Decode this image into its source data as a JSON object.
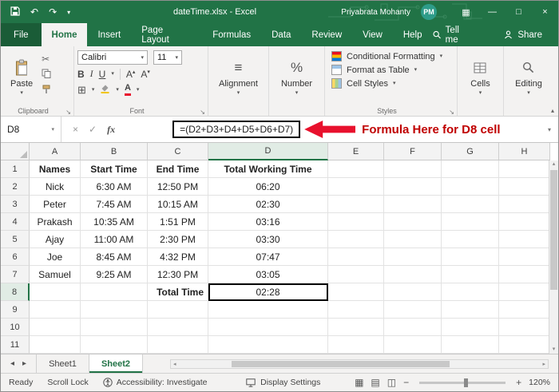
{
  "colors": {
    "excel_green": "#217346",
    "annotation_red": "#C00000",
    "arrow_red": "#E8112D",
    "selection": "#000000"
  },
  "titlebar": {
    "title": "dateTime.xlsx - Excel",
    "user": "Priyabrata Mohanty",
    "avatar": "PM"
  },
  "icons": {
    "undo": "↶",
    "redo": "↷",
    "dropdown": "▾",
    "up": "▴",
    "left": "◂",
    "right": "▸",
    "ribbon_display": "▦",
    "minimize": "—",
    "maximize": "□",
    "close": "×",
    "cancel": "×",
    "enter": "✓",
    "fx": "fx",
    "scissors": "✂",
    "borders": "⊞",
    "align_lines": "≡",
    "percent": "%",
    "bold": "B",
    "italic": "I",
    "underline": "U",
    "view_normal": "▦",
    "view_layout": "▤",
    "view_break": "◫",
    "zoom_out": "−",
    "zoom_in": "+",
    "launcher": "↘"
  },
  "ribbon": {
    "tabs": [
      "File",
      "Home",
      "Insert",
      "Page Layout",
      "Formulas",
      "Data",
      "Review",
      "View",
      "Help"
    ],
    "active_tab": "Home",
    "tell_me": "Tell me",
    "share": "Share"
  },
  "groups": {
    "clipboard": {
      "label": "Clipboard",
      "paste": "Paste"
    },
    "font": {
      "label": "Font",
      "font_name": "Calibri",
      "font_size": "11"
    },
    "alignment": {
      "label": "Alignment"
    },
    "number": {
      "label": "Number"
    },
    "styles": {
      "label": "Styles",
      "items": [
        "Conditional Formatting",
        "Format as Table",
        "Cell Styles"
      ]
    },
    "cells": {
      "label": "Cells"
    },
    "editing": {
      "label": "Editing"
    }
  },
  "formula_bar": {
    "name_box": "D8",
    "formula": "=(D2+D3+D4+D5+D6+D7)",
    "annotation": "Formula Here for D8 cell"
  },
  "grid": {
    "columns": [
      "A",
      "B",
      "C",
      "D",
      "E",
      "F",
      "G",
      "H"
    ],
    "selected_cell": "D8",
    "selected_col": "D",
    "selected_row": "8",
    "bold_cells": [
      "C8"
    ],
    "rows": [
      {
        "n": "1",
        "cells": [
          "Names",
          "Start Time",
          "End Time",
          "Total Working Time",
          "",
          "",
          "",
          ""
        ]
      },
      {
        "n": "2",
        "cells": [
          "Nick",
          "6:30 AM",
          "12:50 PM",
          "06:20",
          "",
          "",
          "",
          ""
        ]
      },
      {
        "n": "3",
        "cells": [
          "Peter",
          "7:45 AM",
          "10:15 AM",
          "02:30",
          "",
          "",
          "",
          ""
        ]
      },
      {
        "n": "4",
        "cells": [
          "Prakash",
          "10:35 AM",
          "1:51 PM",
          "03:16",
          "",
          "",
          "",
          ""
        ]
      },
      {
        "n": "5",
        "cells": [
          "Ajay",
          "11:00 AM",
          "2:30 PM",
          "03:30",
          "",
          "",
          "",
          ""
        ]
      },
      {
        "n": "6",
        "cells": [
          "Joe",
          "8:45 AM",
          "4:32 PM",
          "07:47",
          "",
          "",
          "",
          ""
        ]
      },
      {
        "n": "7",
        "cells": [
          "Samuel",
          "9:25 AM",
          "12:30 PM",
          "03:05",
          "",
          "",
          "",
          ""
        ]
      },
      {
        "n": "8",
        "cells": [
          "",
          "",
          "Total Time",
          "02:28",
          "",
          "",
          "",
          ""
        ]
      },
      {
        "n": "9",
        "cells": [
          "",
          "",
          "",
          "",
          "",
          "",
          "",
          ""
        ]
      },
      {
        "n": "10",
        "cells": [
          "",
          "",
          "",
          "",
          "",
          "",
          "",
          ""
        ]
      },
      {
        "n": "11",
        "cells": [
          "",
          "",
          "",
          "",
          "",
          "",
          "",
          ""
        ]
      }
    ]
  },
  "sheet_bar": {
    "tabs": [
      "Sheet1",
      "Sheet2"
    ],
    "active": "Sheet2"
  },
  "status_bar": {
    "ready": "Ready",
    "scroll_lock": "Scroll Lock",
    "accessibility": "Accessibility: Investigate",
    "display_settings": "Display Settings",
    "zoom": "120%"
  }
}
